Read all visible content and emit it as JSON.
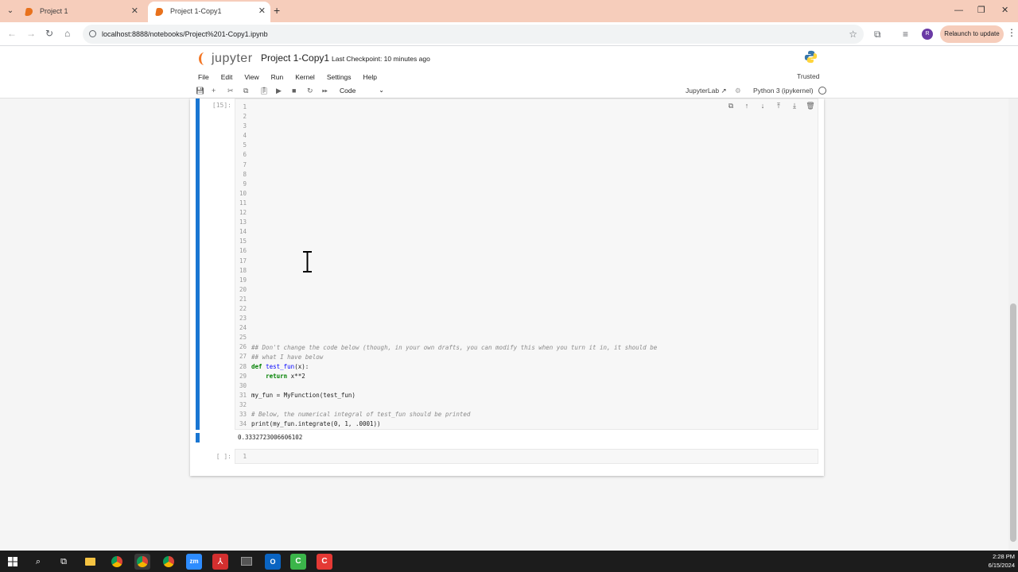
{
  "browser": {
    "tabs": [
      {
        "title": "Project 1",
        "active": false
      },
      {
        "title": "Project 1-Copy1",
        "active": true
      }
    ],
    "url": "localhost:8888/notebooks/Project%201-Copy1.ipynb",
    "relaunch_label": "Relaunch to update",
    "profile_initial": "R",
    "icons": [
      "chevron-down-icon",
      "close-icon",
      "plus-icon",
      "minimize-icon",
      "restore-icon",
      "back-icon",
      "forward-icon",
      "reload-icon",
      "home-icon",
      "star-icon",
      "extension-icon",
      "media-icon",
      "kebab-icon"
    ]
  },
  "jupyter": {
    "logo_text": "jupyter",
    "notebook_title": "Project 1-Copy1",
    "checkpoint": "Last Checkpoint: 10 minutes ago",
    "menu": [
      "File",
      "Edit",
      "View",
      "Run",
      "Kernel",
      "Settings",
      "Help"
    ],
    "trusted": "Trusted",
    "cell_type": "Code",
    "jupyterlab_link": "JupyterLab",
    "kernel": "Python 3 (ipykernel)",
    "accent_color": "#1976d2",
    "brand_color": "#f37726"
  },
  "cells": [
    {
      "prompt": "[15]:",
      "line_numbers": [
        "1",
        "2",
        "3",
        "4",
        "5",
        "6",
        "7",
        "8",
        "9",
        "10",
        "11",
        "12",
        "13",
        "14",
        "15",
        "16",
        "17",
        "18",
        "19",
        "20",
        "21",
        "22",
        "23",
        "24",
        "25",
        "26",
        "27",
        "28",
        "29",
        "30",
        "31",
        "32",
        "33",
        "34"
      ],
      "code_lines": {
        "l26": "## Don't change the code below (though, in your own drafts, you can modify this when you turn it in, it should be",
        "l27": "## what I have below",
        "l28_kw": "def",
        "l28_fn": "test_fun",
        "l28_rest": "(x):",
        "l29_kw": "return",
        "l29_rest": " x**2",
        "l31": "my_fun = MyFunction(test_fun)",
        "l33": "# Below, the numerical integral of test_fun should be printed",
        "l34": "print(my_fun.integrate(0, 1, .0001))"
      },
      "output": "0.3332723006606102"
    },
    {
      "prompt": "[ ]:",
      "line_numbers": [
        "1"
      ]
    }
  ],
  "taskbar": {
    "time": "2:28 PM",
    "date": "6/15/2024",
    "apps": [
      "windows-start-icon",
      "search-icon",
      "task-view-icon",
      "file-explorer-icon",
      "chrome-icon",
      "chrome-profile-icon",
      "chrome-alt-icon",
      "zoom-icon",
      "acrobat-icon",
      "terminal-icon",
      "outlook-icon",
      "camtasia-icon",
      "camtasia-recorder-icon"
    ]
  }
}
